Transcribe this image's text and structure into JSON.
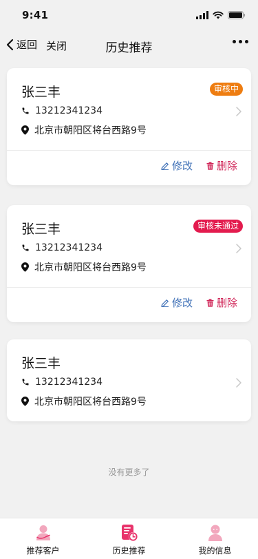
{
  "status_bar": {
    "time": "9:41"
  },
  "nav": {
    "back_label": "返回",
    "close_label": "关闭",
    "title": "历史推荐"
  },
  "cards": [
    {
      "name": "张三丰",
      "phone": "13212341234",
      "address": "北京市朝阳区将台西路9号",
      "badge": "审核中",
      "badge_color": "#ee7d11",
      "edit_label": "修改",
      "delete_label": "删除"
    },
    {
      "name": "张三丰",
      "phone": "13212341234",
      "address": "北京市朝阳区将台西路9号",
      "badge": "审核未通过",
      "badge_color": "#e31b4e",
      "edit_label": "修改",
      "delete_label": "删除"
    },
    {
      "name": "张三丰",
      "phone": "13212341234",
      "address": "北京市朝阳区将台西路9号"
    }
  ],
  "footer_text": "没有更多了",
  "tab_bar": {
    "items": [
      {
        "label": "推荐客户",
        "icon": "recommend-customer-icon"
      },
      {
        "label": "历史推荐",
        "icon": "history-recommend-icon",
        "active": true
      },
      {
        "label": "我的信息",
        "icon": "my-info-icon"
      }
    ],
    "accent_color": "#e8336b"
  }
}
